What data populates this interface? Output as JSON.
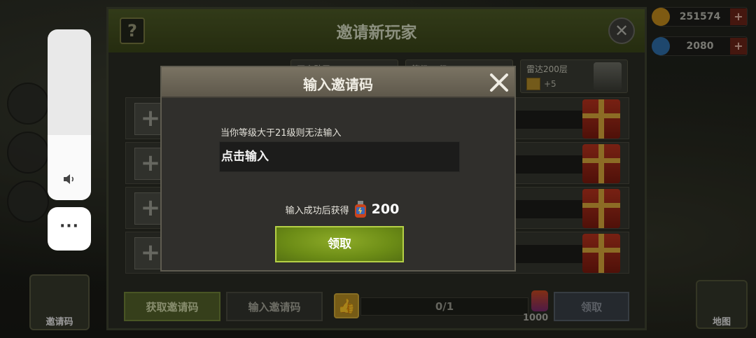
{
  "background_panel": {
    "title": "邀请新玩家",
    "help_icon_text": "?",
    "milestones": [
      {
        "label": "开启勋甲",
        "reward": ""
      },
      {
        "label": "等级30级",
        "reward": ""
      },
      {
        "label": "雷达200层",
        "reward": "+5"
      }
    ],
    "player_slots": [
      "+",
      "+",
      "+",
      "+"
    ],
    "footer": {
      "get_code_label": "获取邀请码",
      "input_code_label": "输入邀请码",
      "progress_text": "0/1",
      "potion_count": "1000",
      "claim_label": "领取"
    }
  },
  "hud": {
    "resource_1": "251574",
    "resource_2": "2080",
    "plus": "+",
    "left_button_label": "邀请码",
    "right_button_label": "地图"
  },
  "system_controls": {
    "volume_level": 0.38,
    "more_label": "···"
  },
  "modal": {
    "title": "输入邀请码",
    "hint": "当你等级大于21级则无法输入",
    "input_placeholder": "点击输入",
    "reward_prefix": "输入成功后获得",
    "reward_amount": "200",
    "claim_label": "领取"
  },
  "colors": {
    "accent_green": "#7a9a1e",
    "modal_header": "#6e685a"
  }
}
